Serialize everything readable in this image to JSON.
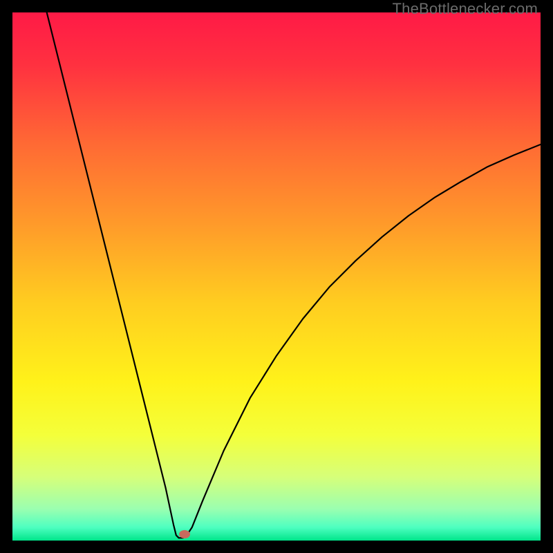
{
  "watermark": "TheBottlenecker.com",
  "chart_data": {
    "type": "line",
    "title": "",
    "xlabel": "",
    "ylabel": "",
    "xlim": [
      0,
      100
    ],
    "ylim": [
      0,
      100
    ],
    "background_gradient": {
      "stops": [
        {
          "pos": 0.0,
          "color": "#ff1a46"
        },
        {
          "pos": 0.1,
          "color": "#ff3140"
        },
        {
          "pos": 0.25,
          "color": "#ff6a34"
        },
        {
          "pos": 0.4,
          "color": "#ff9a2a"
        },
        {
          "pos": 0.55,
          "color": "#ffcd20"
        },
        {
          "pos": 0.7,
          "color": "#fff21a"
        },
        {
          "pos": 0.8,
          "color": "#f4ff3a"
        },
        {
          "pos": 0.88,
          "color": "#d6ff7a"
        },
        {
          "pos": 0.94,
          "color": "#9bffb0"
        },
        {
          "pos": 0.975,
          "color": "#4effc0"
        },
        {
          "pos": 1.0,
          "color": "#00e58a"
        }
      ]
    },
    "curve": [
      {
        "x": 6.5,
        "y": 100.0
      },
      {
        "x": 9.0,
        "y": 90.0
      },
      {
        "x": 12.0,
        "y": 78.0
      },
      {
        "x": 15.0,
        "y": 66.0
      },
      {
        "x": 18.0,
        "y": 54.0
      },
      {
        "x": 21.0,
        "y": 42.0
      },
      {
        "x": 24.0,
        "y": 30.0
      },
      {
        "x": 27.0,
        "y": 18.0
      },
      {
        "x": 29.0,
        "y": 10.0
      },
      {
        "x": 30.5,
        "y": 3.0
      },
      {
        "x": 31.0,
        "y": 1.0
      },
      {
        "x": 31.5,
        "y": 0.5
      },
      {
        "x": 32.3,
        "y": 0.5
      },
      {
        "x": 33.0,
        "y": 1.0
      },
      {
        "x": 34.0,
        "y": 2.5
      },
      {
        "x": 36.0,
        "y": 7.5
      },
      {
        "x": 40.0,
        "y": 17.0
      },
      {
        "x": 45.0,
        "y": 27.0
      },
      {
        "x": 50.0,
        "y": 35.0
      },
      {
        "x": 55.0,
        "y": 42.0
      },
      {
        "x": 60.0,
        "y": 48.0
      },
      {
        "x": 65.0,
        "y": 53.0
      },
      {
        "x": 70.0,
        "y": 57.5
      },
      {
        "x": 75.0,
        "y": 61.5
      },
      {
        "x": 80.0,
        "y": 65.0
      },
      {
        "x": 85.0,
        "y": 68.0
      },
      {
        "x": 90.0,
        "y": 70.8
      },
      {
        "x": 95.0,
        "y": 73.0
      },
      {
        "x": 100.0,
        "y": 75.0
      }
    ],
    "marker": {
      "x": 32.6,
      "y": 1.2,
      "color": "#c76a5e",
      "rx": 8,
      "ry": 6
    }
  }
}
